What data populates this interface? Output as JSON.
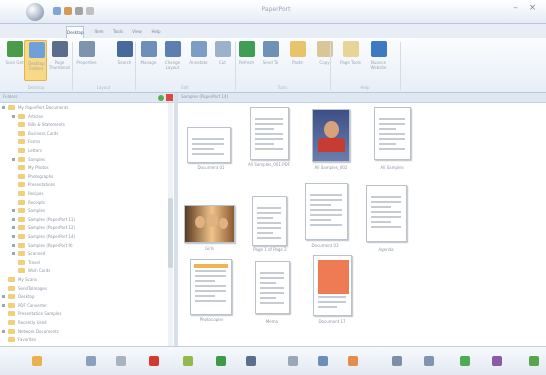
{
  "window": {
    "title": "PaperPort"
  },
  "tabs": [
    {
      "label": "Desktop"
    },
    {
      "label": "Item"
    },
    {
      "label": "Tools"
    },
    {
      "label": "View"
    },
    {
      "label": "Help"
    }
  ],
  "ribbon": {
    "buttons": [
      {
        "label": "Scan Get",
        "color": "#4a9b4a",
        "icon": "scan-icon"
      },
      {
        "label": "Desktop Folders",
        "color": "#6fa0d8",
        "icon": "folder-view-icon"
      },
      {
        "label": "Page Thumbnail",
        "color": "#5b6e8c",
        "icon": "thumbnail-icon"
      },
      {
        "label": "Properties",
        "color": "#7e93ad",
        "icon": "properties-icon"
      },
      {
        "label": "Search",
        "color": "#466a99",
        "icon": "search-icon"
      },
      {
        "label": "Manage",
        "color": "#6e8fb7",
        "icon": "manage-icon"
      },
      {
        "label": "Change Layout",
        "color": "#5d7fb0",
        "icon": "layout-icon"
      },
      {
        "label": "Annotate",
        "color": "#7d9dc4",
        "icon": "annotate-icon"
      },
      {
        "label": "Cut",
        "color": "#9cb2cc",
        "icon": "cut-icon"
      },
      {
        "label": "Refresh",
        "color": "#3f9e54",
        "icon": "refresh-icon"
      },
      {
        "label": "Send To",
        "color": "#7091b6",
        "icon": "send-to-icon"
      },
      {
        "label": "Paste",
        "color": "#e8c36c",
        "icon": "paste-icon"
      },
      {
        "label": "Copy",
        "color": "#d8c59a",
        "icon": "copy-icon"
      },
      {
        "label": "Page Tools",
        "color": "#e7d496",
        "icon": "page-tools-icon"
      },
      {
        "label": "Nuance Website",
        "color": "#3c7bc2",
        "icon": "globe-icon"
      }
    ],
    "groups": [
      {
        "label": "Desktop"
      },
      {
        "label": "Layout"
      },
      {
        "label": "Edit"
      },
      {
        "label": "Tools"
      },
      {
        "label": "Help"
      }
    ]
  },
  "left_panel": {
    "header": "Folders",
    "tree": [
      {
        "label": "My PaperPort Documents",
        "level": 0,
        "expand": true
      },
      {
        "label": "Articles",
        "level": 1,
        "expand": true
      },
      {
        "label": "Bills & Statements",
        "level": 1,
        "expand": false
      },
      {
        "label": "Business Cards",
        "level": 1,
        "expand": false
      },
      {
        "label": "Forms",
        "level": 1,
        "expand": false
      },
      {
        "label": "Letters",
        "level": 1,
        "expand": false
      },
      {
        "label": "Samples",
        "level": 1,
        "expand": true
      },
      {
        "label": "My Photos",
        "level": 1,
        "expand": false
      },
      {
        "label": "Photographs",
        "level": 1,
        "expand": false
      },
      {
        "label": "Presentations",
        "level": 1,
        "expand": false
      },
      {
        "label": "Recipes",
        "level": 1,
        "expand": false
      },
      {
        "label": "Receipts",
        "level": 1,
        "expand": false
      },
      {
        "label": "Samples",
        "level": 1,
        "expand": true
      },
      {
        "label": "Samples (PaperPort 11)",
        "level": 1,
        "expand": true
      },
      {
        "label": "Samples (PaperPort 12)",
        "level": 1,
        "expand": true
      },
      {
        "label": "Samples (PaperPort 14)",
        "level": 1,
        "expand": true
      },
      {
        "label": "Samples (PaperPort 9)",
        "level": 1,
        "expand": true
      },
      {
        "label": "Scanned",
        "level": 1,
        "expand": true
      },
      {
        "label": "Travel",
        "level": 1,
        "expand": false
      },
      {
        "label": "Wish Cards",
        "level": 1,
        "expand": false
      },
      {
        "label": "My Scans",
        "level": 0,
        "expand": false
      },
      {
        "label": "SendToImages",
        "level": 0,
        "expand": false
      },
      {
        "label": "Desktop",
        "level": 0,
        "expand": true
      },
      {
        "label": "PDF Converter",
        "level": 0,
        "expand": true
      },
      {
        "label": "Presentation Samples",
        "level": 0,
        "expand": false
      },
      {
        "label": "Recently Used",
        "level": 0,
        "expand": false
      },
      {
        "label": "Network Documents",
        "level": 0,
        "expand": true
      },
      {
        "label": "Favorites",
        "level": 0,
        "expand": false
      }
    ]
  },
  "thumb_panel": {
    "header": "Samples (PaperPort 14)",
    "items": [
      {
        "caption": "Document 01",
        "kind": "doc"
      },
      {
        "caption": "All Samples_001.PDF",
        "kind": "doc"
      },
      {
        "caption": "All Samples_002",
        "kind": "kid"
      },
      {
        "caption": "All Samples",
        "kind": "doc"
      },
      {
        "caption": "Girls",
        "kind": "group"
      },
      {
        "caption": "Page 1 of Page 2",
        "kind": "doc"
      },
      {
        "caption": "Document 03",
        "kind": "doc"
      },
      {
        "caption": "Agenda",
        "kind": "doc"
      },
      {
        "caption": "Photocopier",
        "kind": "orange"
      },
      {
        "caption": "Memo",
        "kind": "doc"
      },
      {
        "caption": "Document 17",
        "kind": "red"
      }
    ]
  },
  "bottom_bar": {
    "icons": [
      {
        "icon": "folder-icon",
        "color": "#e8b24c"
      },
      {
        "icon": "scanner-icon",
        "color": "#8aa0bd"
      },
      {
        "icon": "printer-icon",
        "color": "#a9b3c0"
      },
      {
        "icon": "pdf-icon",
        "color": "#d33a2f"
      },
      {
        "icon": "pen-icon",
        "color": "#92b84e"
      },
      {
        "icon": "excel-icon",
        "color": "#3f9a48"
      },
      {
        "icon": "text-icon",
        "color": "#5b6f8d"
      },
      {
        "icon": "ocr-icon",
        "color": "#9aa7b8"
      },
      {
        "icon": "word-icon",
        "color": "#6c8fb9"
      },
      {
        "icon": "image-icon",
        "color": "#e68c4c"
      },
      {
        "icon": "fax-icon",
        "color": "#7d8ea8"
      },
      {
        "icon": "email-icon",
        "color": "#8094b0"
      },
      {
        "icon": "web-icon",
        "color": "#4cab53"
      },
      {
        "icon": "share-icon",
        "color": "#8a5aa6"
      },
      {
        "icon": "more-icon",
        "color": "#59a54c"
      }
    ]
  }
}
